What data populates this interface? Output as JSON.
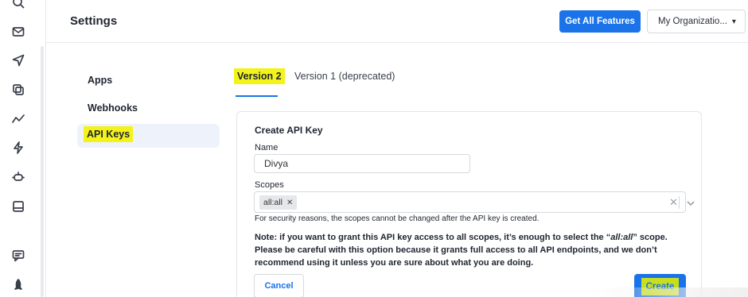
{
  "header": {
    "title": "Settings",
    "features_button": "Get All Features",
    "org_select": "My Organizatio..."
  },
  "rail_icons": [
    "search-icon",
    "mail-icon",
    "send-icon",
    "copy-icon",
    "activity-icon",
    "zap-icon",
    "robot-icon",
    "inbox-icon",
    "chat-icon",
    "rocket-icon"
  ],
  "nav": {
    "items": [
      {
        "label": "Apps"
      },
      {
        "label": "Webhooks"
      },
      {
        "label": "API Keys",
        "active": true
      }
    ]
  },
  "tabs": [
    {
      "label": "Version 2",
      "active": true
    },
    {
      "label": "Version 1 (deprecated)"
    }
  ],
  "form": {
    "title": "Create API Key",
    "name_label": "Name",
    "name_value": "Divya",
    "scopes_label": "Scopes",
    "scopes": [
      "all:all"
    ],
    "security_note": "For security reasons, the scopes cannot be changed after the API key is created.",
    "warn_prefix": "Note: if you want to grant this API key access to all scopes, it’s enough to select the “",
    "warn_scope": "all:all",
    "warn_suffix": "” scope. Please be careful with this option because it grants full access to all API endpoints, and we don’t recommend using it unless you are sure about what you are doing.",
    "cancel_label": "Cancel",
    "create_label": "Create"
  },
  "colors": {
    "accent": "#1a73e8",
    "highlight": "#f3f31a",
    "active_nav_bg": "#eef3fb"
  }
}
